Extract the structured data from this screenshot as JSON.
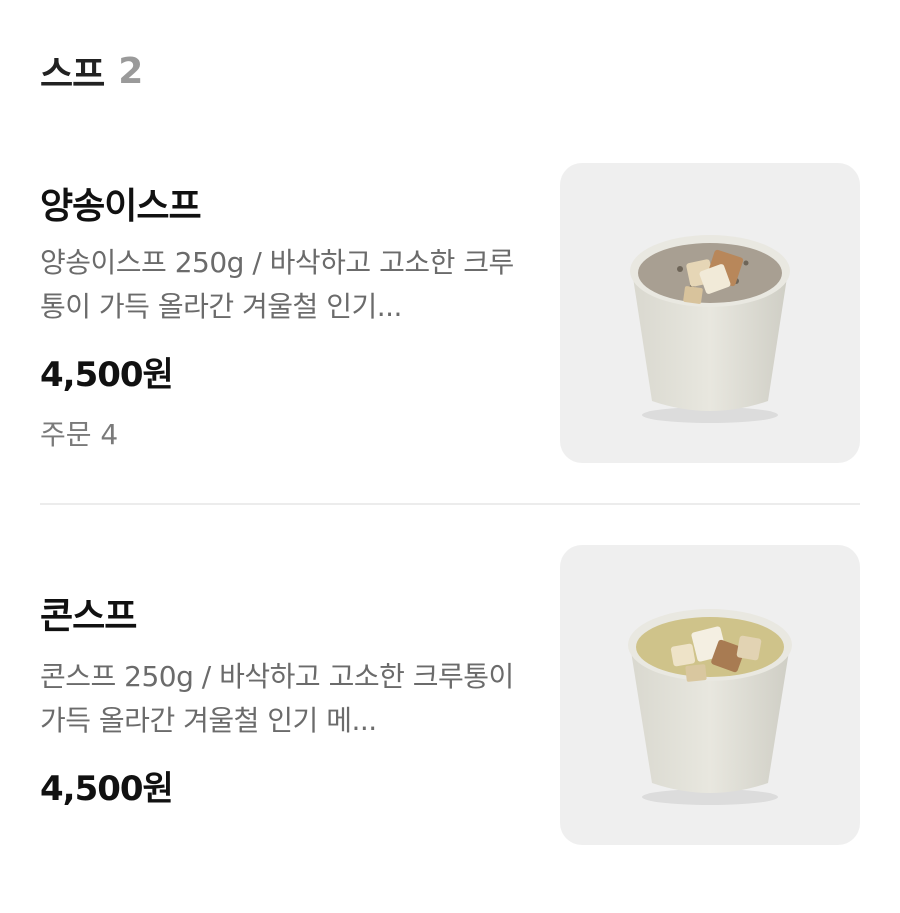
{
  "section": {
    "title": "스프",
    "count": "2"
  },
  "items": [
    {
      "name": "양송이스프",
      "description": "양송이스프 250g / 바삭하고 고소한 크루통이 가득 올라간 겨울철 인기...",
      "price": "4,500원",
      "orders": "주문 4",
      "image_icon": "mushroom-soup-cup",
      "soup_color": "#a89f92"
    },
    {
      "name": "콘스프",
      "description": "콘스프 250g / 바삭하고 고소한 크루통이 가득 올라간 겨울철 인기 메...",
      "price": "4,500원",
      "image_icon": "corn-soup-cup",
      "soup_color": "#cfc38a"
    }
  ],
  "colors": {
    "title_text": "#111111",
    "secondary_text": "#6b6b6b",
    "count_text": "#9a9a9a",
    "thumb_background": "#efefef",
    "divider": "#ececec"
  }
}
